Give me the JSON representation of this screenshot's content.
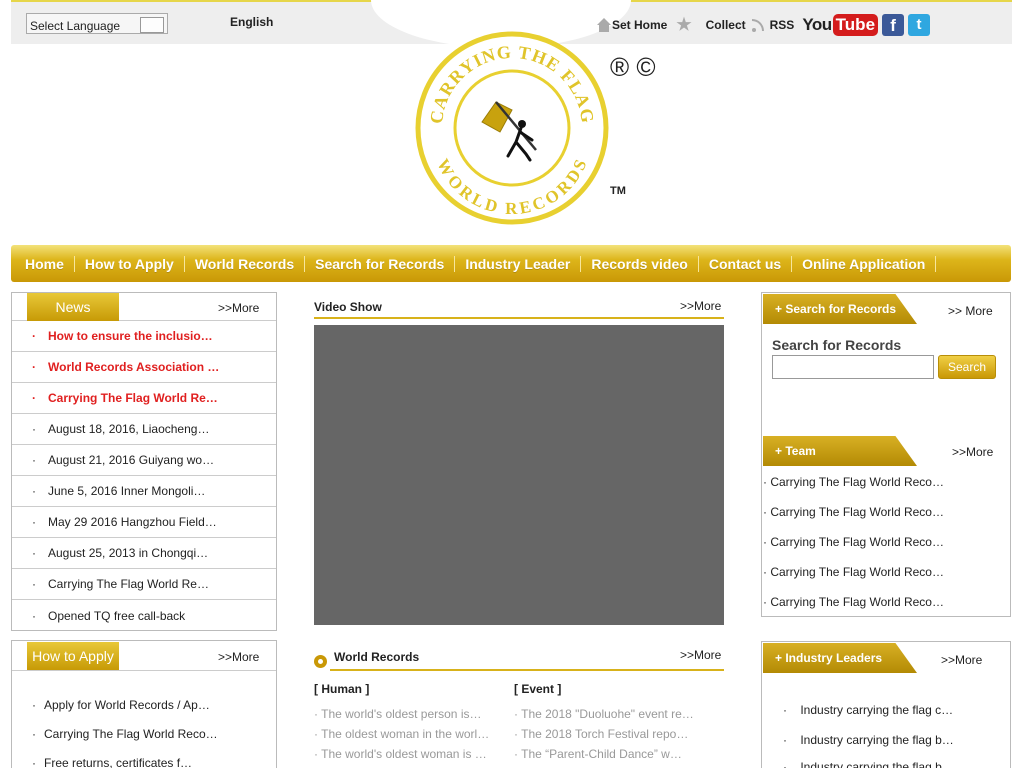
{
  "topbar": {
    "language_select": "Select Language",
    "language_current": "English",
    "set_home": "Set Home",
    "collect": "Collect",
    "rss": "RSS",
    "youtube_you": "You",
    "youtube_tube": "Tube",
    "facebook_glyph": "f",
    "twitter_glyph": "t"
  },
  "logo": {
    "text_top": "CARRYING THE FLAG",
    "text_bottom": "WORLD RECORDS",
    "marks": "® ©",
    "tm": "TM"
  },
  "nav": [
    "Home",
    "How to Apply",
    "World Records",
    "Search for Records",
    "Industry Leader",
    "Records video",
    "Contact us",
    "Online Application"
  ],
  "news": {
    "tab": "News",
    "more": ">>More",
    "items": [
      {
        "text": "How to ensure the inclusio…",
        "hot": true
      },
      {
        "text": "World Records Association …",
        "hot": true
      },
      {
        "text": "Carrying The Flag World Re…",
        "hot": true
      },
      {
        "text": "August 18, 2016, Liaocheng…",
        "hot": false
      },
      {
        "text": "August 21, 2016 Guiyang wo…",
        "hot": false
      },
      {
        "text": "June 5, 2016 Inner Mongoli…",
        "hot": false
      },
      {
        "text": "May 29 2016 Hangzhou Field…",
        "hot": false
      },
      {
        "text": "August 25, 2013 in Chongqi…",
        "hot": false
      },
      {
        "text": "Carrying The Flag World Re…",
        "hot": false
      },
      {
        "text": "Opened TQ free call-back",
        "hot": false
      }
    ]
  },
  "apply": {
    "tab": "How to Apply",
    "more": ">>More",
    "items": [
      "Apply for World Records / Ap…",
      "Carrying The Flag World Reco…",
      "Free returns, certificates f…"
    ]
  },
  "video_show": {
    "title": "Video Show",
    "more": ">>More"
  },
  "world_records": {
    "title": "World Records",
    "more": ">>More",
    "human_header": "[ Human ]",
    "event_header": "[ Event ]",
    "human": [
      "The world's oldest person is…",
      "The oldest woman in the worl…",
      "The world's oldest woman is …"
    ],
    "event": [
      "The 2018 \"Duoluohe\" event re…",
      "The 2018 Torch Festival repo…",
      "The “Parent-Child Dance” w…"
    ]
  },
  "search": {
    "tab": "Search for Records",
    "more": ">> More",
    "label": "Search for Records",
    "input_value": "",
    "button": "Search"
  },
  "team": {
    "tab": "Team",
    "more": ">>More",
    "items": [
      "Carrying The Flag World Reco…",
      "Carrying The Flag World Reco…",
      "Carrying The Flag World Reco…",
      "Carrying The Flag World Reco…",
      "Carrying The Flag World Reco…"
    ]
  },
  "industry": {
    "tab": "Industry Leaders",
    "more": ">>More",
    "items": [
      "Industry carrying the flag c…",
      "Industry carrying the flag b…",
      "Industry carrying the flag b…"
    ]
  },
  "colors": {
    "gold": "#d8b21a",
    "hot_red": "#e02020",
    "video_bg": "#666666"
  }
}
